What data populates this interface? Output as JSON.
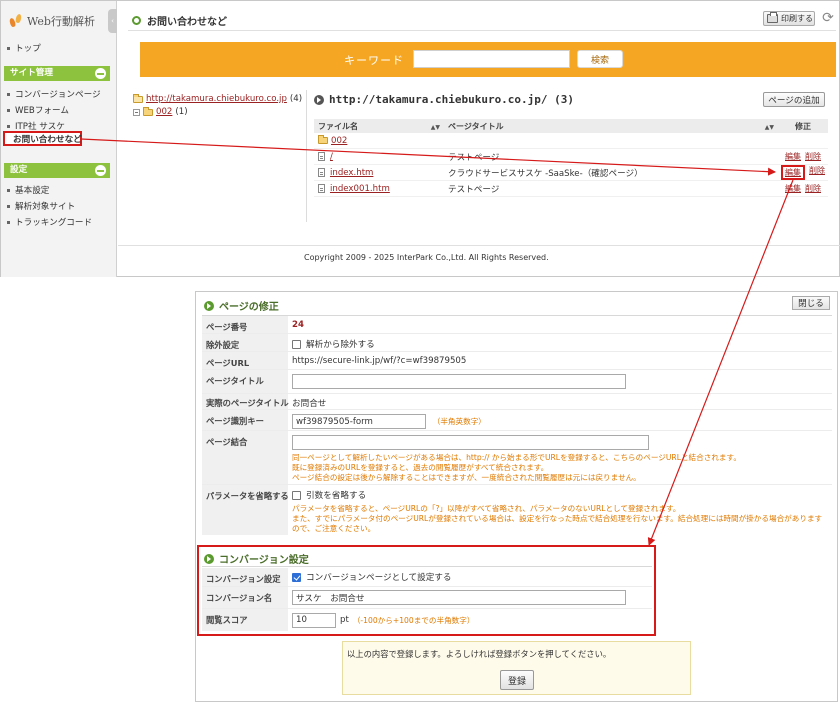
{
  "sidebar": {
    "logo_text": "Web行動解析",
    "top_link": "トップ",
    "site_section": "サイト管理",
    "site_items": [
      "コンバージョンページ",
      "WEBフォーム",
      "ITP社 サスケ",
      "お問い合わせなど"
    ],
    "settings_section": "設定",
    "settings_items": [
      "基本設定",
      "解析対象サイト",
      "トラッキングコード"
    ]
  },
  "header": {
    "title": "お問い合わせなど",
    "print_label": "印刷する"
  },
  "search": {
    "label": "キーワード",
    "value": "",
    "button": "検索"
  },
  "tree": {
    "root_link": "http://takamura.chiebukuro.co.jp",
    "root_count": "(4)",
    "child_link": "002",
    "child_count": "(1)"
  },
  "directory": {
    "heading": "http://takamura.chiebukuro.co.jp/ (3)",
    "add_button": "ページの追加",
    "columns": {
      "file": "ファイル名",
      "title": "ページタイトル",
      "edit": "修正"
    },
    "folder_row": "002",
    "rows": [
      {
        "file": "/",
        "title": "テストページ",
        "edit": "編集",
        "delete": "削除"
      },
      {
        "file": "index.htm",
        "title": "クラウドサービスサスケ -SaaSke-（確認ページ）",
        "edit": "編集",
        "delete": "削除"
      },
      {
        "file": "index001.htm",
        "title": "テストページ",
        "edit": "編集",
        "delete": "削除"
      }
    ]
  },
  "footer": {
    "copyright": "Copyright 2009 - 2025 InterPark Co.,Ltd. All Rights Reserved."
  },
  "edit_panel": {
    "heading": "ページの修正",
    "close_button": "閉じる",
    "page_number_label": "ページ番号",
    "page_number": "24",
    "exclude_label": "除外設定",
    "exclude_option": "解析から除外する",
    "url_label": "ページURL",
    "url_value": "https://secure-link.jp/wf/?c=wf39879505",
    "page_title_label": "ページタイトル",
    "page_title_value": "",
    "actual_title_label": "実際のページタイトル",
    "actual_title_value": "お問合せ",
    "key_label": "ページ識別キー",
    "key_value": "wf39879505-form",
    "key_hint": "（半角英数字）",
    "merge_label": "ページ結合",
    "merge_value": "",
    "merge_note_1": "同一ページとして解析したいページがある場合は、http:// から始まる形でURLを登録すると、こちらのページURLと結合されます。",
    "merge_note_2": "既に登録済みのURLを登録すると、過去の閲覧履歴がすべて統合されます。",
    "merge_note_3": "ページ結合の設定は後から解除することはできますが、一度統合された閲覧履歴は元には戻りません。",
    "param_label": "パラメータを省略する",
    "param_option": "引数を省略する",
    "param_note_1": "パラメータを省略すると、ページURLの「?」以降がすべて省略され、パラメータのないURLとして登録されます。",
    "param_note_2": "また、すでにパラメータ付のページURLが登録されている場合は、設定を行なった時点で結合処理を行ないます。結合処理には時間が掛かる場合がありますので、ご注意ください。"
  },
  "conversion": {
    "heading": "コンバージョン設定",
    "setting_label": "コンバージョン設定",
    "setting_option": "コンバージョンページとして設定する",
    "name_label": "コンバージョン名",
    "name_value": "サスケ　お問合せ",
    "score_label": "閲覧スコア",
    "score_value": "10",
    "score_unit": "pt",
    "score_hint": "（-100から+100までの半角数字）"
  },
  "confirm": {
    "message": "以上の内容で登録します。よろしければ登録ボタンを押してください。",
    "register_button": "登録"
  },
  "colors": {
    "accent_orange": "#f5a623",
    "section_green": "#8dc23f",
    "highlight_red": "#d61a1a",
    "link_red": "#9b2222",
    "hint_orange": "#e07a00"
  },
  "icons": [
    "logo-icon",
    "printer-icon",
    "refresh-icon",
    "folder-icon",
    "doc-icon",
    "arrow-circle-icon",
    "minus-icon",
    "checkbox-icon"
  ]
}
